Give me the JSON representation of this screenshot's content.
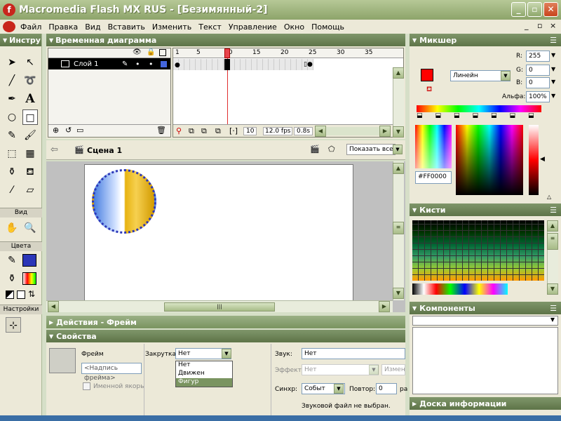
{
  "window": {
    "title": "Macromedia Flash MX RUS - [Безимянный-2]",
    "logo": "f",
    "min": "_",
    "max": "▫",
    "close": "✕"
  },
  "menu": {
    "items": [
      "Файл",
      "Правка",
      "Вид",
      "Вставить",
      "Изменить",
      "Текст",
      "Управление",
      "Окно",
      "Помощь"
    ],
    "doc_min": "_",
    "doc_max": "▫",
    "doc_close": "×"
  },
  "tools": {
    "title": "Инстру",
    "sections": {
      "view": "Вид",
      "colors": "Цвета",
      "options": "Настройки"
    }
  },
  "timeline": {
    "title": "Временная диаграмма",
    "ruler": [
      "1",
      "5",
      "10",
      "15",
      "20",
      "25",
      "30",
      "35"
    ],
    "layer_name": "Слой 1",
    "current_frame": "10",
    "fps": "12.0 fps",
    "time": "0.8s"
  },
  "scene": {
    "label": "Сцена 1",
    "zoom": "Показать все"
  },
  "actions_panel": {
    "title": "Действия - Фрейм"
  },
  "properties": {
    "title": "Свойства",
    "frame_label": "Фрейм",
    "frame_placeholder": "<Надпись фрейма>",
    "named_anchor": "Именной якорь",
    "tween_label": "Закрутка:",
    "tween_value": "Нет",
    "tween_options": [
      "Нет",
      "Движен",
      "Фигур"
    ],
    "sound_label": "Звук:",
    "sound_value": "Нет",
    "effect_label": "Эффект:",
    "effect_value": "Нет",
    "edit_label": "Измени",
    "sync_label": "Синхр:",
    "sync_value": "Событ",
    "repeat_label": "Повтор:",
    "repeat_value": "0",
    "repeat_unit": "ра",
    "no_sound": "Звуковой файл не выбран."
  },
  "mixer": {
    "title": "Микшер",
    "fill_type": "Линейн",
    "r_label": "R:",
    "r_value": "255",
    "g_label": "G:",
    "g_value": "0",
    "b_label": "B:",
    "b_value": "0",
    "alpha_label": "Альфа:",
    "alpha_value": "100%",
    "hex": "#FF0000"
  },
  "swatches": {
    "title": "Кисти"
  },
  "components": {
    "title": "Компоненты"
  },
  "info": {
    "title": "Доска информации"
  },
  "colors": {
    "accent": "#7a9460",
    "stroke": "#2b36b8",
    "fill": "#ff0000"
  }
}
